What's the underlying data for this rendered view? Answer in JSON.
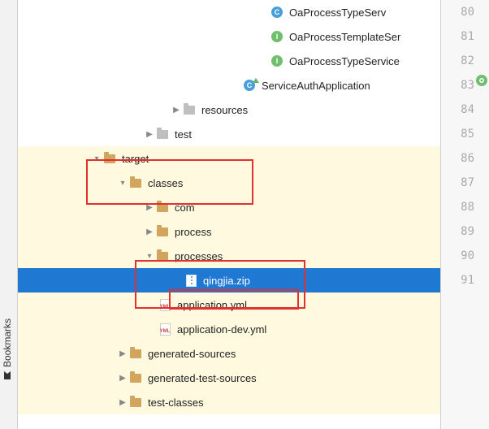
{
  "sidebar": {
    "bookmarks_label": "Bookmarks"
  },
  "tree": {
    "r0": "OaProcessTypeServ",
    "r1": "OaProcessTemplateSer",
    "r2": "OaProcessTypeService",
    "r3": "ServiceAuthApplication",
    "r4": "resources",
    "r5": "test",
    "r6": "target",
    "r7": "classes",
    "r8": "com",
    "r9": "process",
    "r10": "processes",
    "r11": "qingjia.zip",
    "r12": "application.yml",
    "r13": "application-dev.yml",
    "r14": "generated-sources",
    "r15": "generated-test-sources",
    "r16": "test-classes"
  },
  "icons": {
    "class_letter": "C",
    "interface_letter": "I",
    "yml_tag": "YML"
  },
  "gutter": {
    "start": 80,
    "end": 91
  }
}
